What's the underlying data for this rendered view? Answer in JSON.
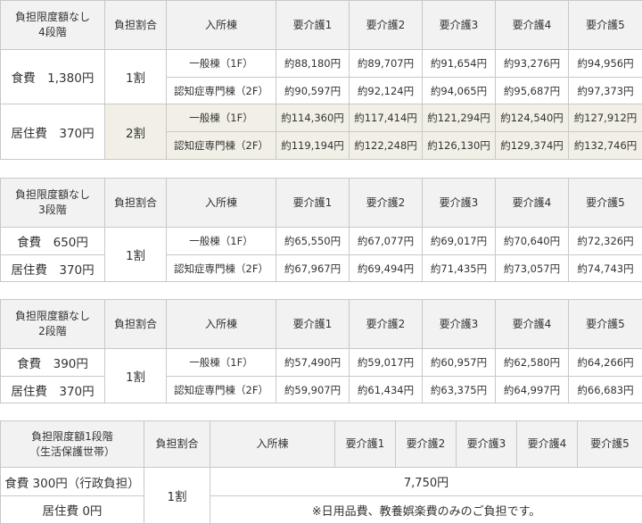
{
  "tables": [
    {
      "header": {
        "limit_line1": "負担限度額なし",
        "limit_line2": "4段階",
        "ratio": "負担割合",
        "building": "入所棟",
        "levels": [
          "要介護1",
          "要介護2",
          "要介護3",
          "要介護4",
          "要介護5"
        ]
      },
      "groups": [
        {
          "cost": "食費　1,380円",
          "ratio": "1割",
          "rows": [
            {
              "building": "一般棟（1F）",
              "values": [
                "約88,180円",
                "約89,707円",
                "約91,654円",
                "約93,276円",
                "約94,956円"
              ]
            },
            {
              "building": "認知症専門棟（2F）",
              "values": [
                "約90,597円",
                "約92,124円",
                "約94,065円",
                "約95,687円",
                "約97,373円"
              ]
            }
          ]
        },
        {
          "cost": "居住費　370円",
          "ratio": "2割",
          "rows": [
            {
              "building": "一般棟（1F）",
              "values": [
                "約114,360円",
                "約117,414円",
                "約121,294円",
                "約124,540円",
                "約127,912円"
              ]
            },
            {
              "building": "認知症専門棟（2F）",
              "values": [
                "約119,194円",
                "約122,248円",
                "約126,130円",
                "約129,374円",
                "約132,746円"
              ]
            }
          ]
        }
      ]
    },
    {
      "header": {
        "limit_line1": "負担限度額なし",
        "limit_line2": "3段階",
        "ratio": "負担割合",
        "building": "入所棟",
        "levels": [
          "要介護1",
          "要介護2",
          "要介護3",
          "要介護4",
          "要介護5"
        ]
      },
      "costs": [
        "食費　650円",
        "居住費　370円"
      ],
      "ratio": "1割",
      "rows": [
        {
          "building": "一般棟（1F）",
          "values": [
            "約65,550円",
            "約67,077円",
            "約69,017円",
            "約70,640円",
            "約72,326円"
          ]
        },
        {
          "building": "認知症専門棟（2F）",
          "values": [
            "約67,967円",
            "約69,494円",
            "約71,435円",
            "約73,057円",
            "約74,743円"
          ]
        }
      ]
    },
    {
      "header": {
        "limit_line1": "負担限度額なし",
        "limit_line2": "2段階",
        "ratio": "負担割合",
        "building": "入所棟",
        "levels": [
          "要介護1",
          "要介護2",
          "要介護3",
          "要介護4",
          "要介護5"
        ]
      },
      "costs": [
        "食費　390円",
        "居住費　370円"
      ],
      "ratio": "1割",
      "rows": [
        {
          "building": "一般棟（1F）",
          "values": [
            "約57,490円",
            "約59,017円",
            "約60,957円",
            "約62,580円",
            "約64,266円"
          ]
        },
        {
          "building": "認知症専門棟（2F）",
          "values": [
            "約59,907円",
            "約61,434円",
            "約63,375円",
            "約64,997円",
            "約66,683円"
          ]
        }
      ]
    },
    {
      "header": {
        "limit_line1": "負担限度額1段階",
        "limit_line2": "（生活保護世帯）",
        "ratio": "負担割合",
        "building": "入所棟",
        "levels": [
          "要介護1",
          "要介護2",
          "要介護3",
          "要介護4",
          "要介護5"
        ]
      },
      "costs": [
        "食費 300円（行政負担）",
        "居住費 0円"
      ],
      "ratio": "1割",
      "amount": "7,750円",
      "note": "※日用品費、教養娯楽費のみのご負担です。"
    }
  ]
}
